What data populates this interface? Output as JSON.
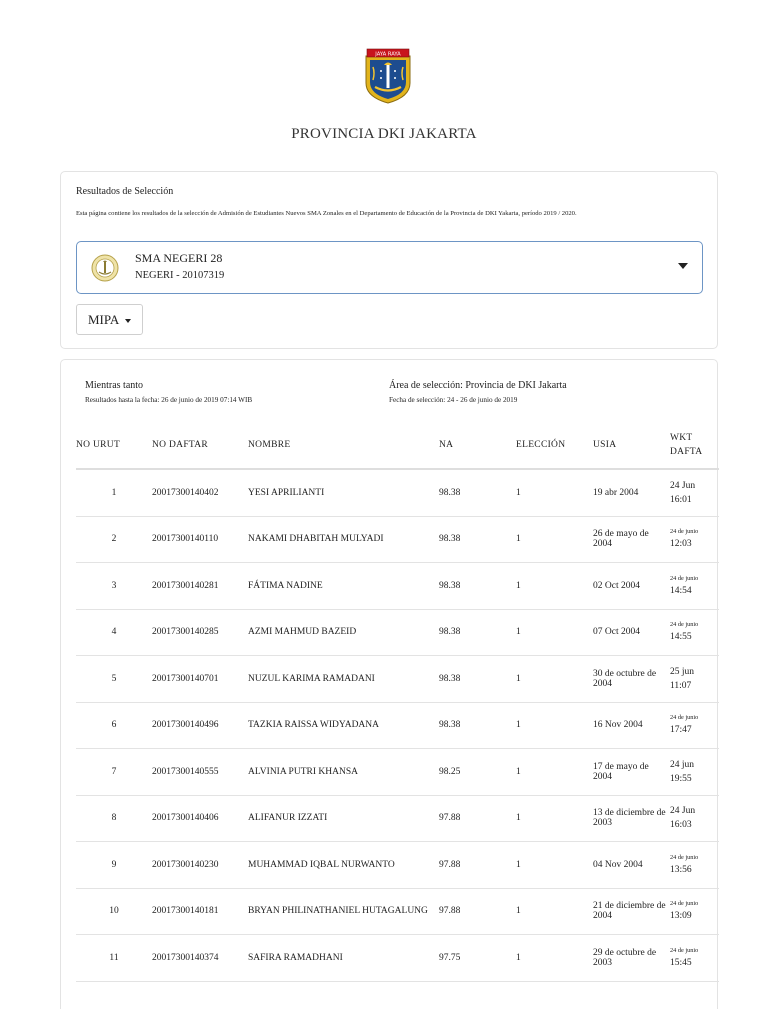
{
  "header": {
    "province_title": "PROVINCIA DKI JAKARTA",
    "logo_banner_text": "JAYA RAYA"
  },
  "selection": {
    "title": "Resultados de Selección",
    "description": "Esta página contiene los resultados de la selección de Admisión de Estudiantes Nuevos SMA Zonales en el Departamento de Educación de la Provincia de DKI Yakarta, período 2019 / 2020.",
    "school_name": "SMA NEGERI 28",
    "school_code": "NEGERI - 20107319",
    "track": "MIPA"
  },
  "results": {
    "status_label": "Mientras tanto",
    "results_date": "Resultados hasta la fecha: 26 de junio de 2019 07:14 WIB",
    "area_label": "Área de selección: Provincia de DKI Jakarta",
    "selection_dates": "Fecha de selección: 24 - 26 de junio de 2019",
    "columns": [
      "NO URUT",
      "NO DAFTAR",
      "NOMBRE",
      "NA",
      "ELECCIÓN",
      "USIA",
      "WKT DAFTA"
    ],
    "rows": [
      {
        "no": "1",
        "daftar": "20017300140402",
        "nombre": "YESI APRILIANTI",
        "na": "98.38",
        "eleccion": "1",
        "usia": "19 abr 2004",
        "usia_small": false,
        "wkt_date": "24 Jun",
        "wkt_time": "16:01",
        "wkt_small": false
      },
      {
        "no": "2",
        "daftar": "20017300140110",
        "nombre": "NAKAMI DHABITAH MULYADI",
        "na": "98.38",
        "eleccion": "1",
        "usia": "26 de mayo de 2004",
        "usia_small": true,
        "wkt_date": "24 de junio",
        "wkt_time": "12:03",
        "wkt_small": true
      },
      {
        "no": "3",
        "daftar": "20017300140281",
        "nombre": "FÁTIMA NADINE",
        "na": "98.38",
        "eleccion": "1",
        "usia": "02 Oct 2004",
        "usia_small": false,
        "wkt_date": "24 de junio",
        "wkt_time": "14:54",
        "wkt_small": true
      },
      {
        "no": "4",
        "daftar": "20017300140285",
        "nombre": "AZMI MAHMUD BAZEID",
        "na": "98.38",
        "eleccion": "1",
        "usia": "07 Oct 2004",
        "usia_small": false,
        "wkt_date": "24 de junio",
        "wkt_time": "14:55",
        "wkt_small": true
      },
      {
        "no": "5",
        "daftar": "20017300140701",
        "nombre": "NUZUL KARIMA RAMADANI",
        "na": "98.38",
        "eleccion": "1",
        "usia": "30 de octubre de 2004",
        "usia_small": true,
        "wkt_date": "25 jun",
        "wkt_time": "11:07",
        "wkt_small": false
      },
      {
        "no": "6",
        "daftar": "20017300140496",
        "nombre": "TAZKIA RAISSA WIDYADANA",
        "na": "98.38",
        "eleccion": "1",
        "usia": "16 Nov 2004",
        "usia_small": false,
        "wkt_date": "24 de junio",
        "wkt_time": "17:47",
        "wkt_small": true
      },
      {
        "no": "7",
        "daftar": "20017300140555",
        "nombre": "ALVINIA PUTRI KHANSA",
        "na": "98.25",
        "eleccion": "1",
        "usia": "17 de mayo de 2004",
        "usia_small": true,
        "wkt_date": "24 jun",
        "wkt_time": "19:55",
        "wkt_small": false
      },
      {
        "no": "8",
        "daftar": "20017300140406",
        "nombre": "ALIFANUR IZZATI",
        "na": "97.88",
        "eleccion": "1",
        "usia": "13 de diciembre de 2003",
        "usia_small": true,
        "wkt_date": "24 Jun",
        "wkt_time": "16:03",
        "wkt_small": false
      },
      {
        "no": "9",
        "daftar": "20017300140230",
        "nombre": "MUHAMMAD IQBAL NURWANTO",
        "na": "97.88",
        "eleccion": "1",
        "usia": "04 Nov 2004",
        "usia_small": false,
        "wkt_date": "24 de junio",
        "wkt_time": "13:56",
        "wkt_small": true
      },
      {
        "no": "10",
        "daftar": "20017300140181",
        "nombre": "BRYAN PHILINATHANIEL HUTAGALUNG",
        "na": "97.88",
        "eleccion": "1",
        "usia": "21 de diciembre de 2004",
        "usia_small": true,
        "wkt_date": "24 de junio",
        "wkt_time": "13:09",
        "wkt_small": true
      },
      {
        "no": "11",
        "daftar": "20017300140374",
        "nombre": "SAFIRA RAMADHANI",
        "na": "97.75",
        "eleccion": "1",
        "usia": "29 de octubre de 2003",
        "usia_small": true,
        "wkt_date": "24 de junio",
        "wkt_time": "15:45",
        "wkt_small": true
      }
    ]
  },
  "icons": {
    "logo": "dki-jakarta-crest-icon",
    "school": "school-emblem-icon",
    "dropdown": "chevron-down-icon"
  },
  "colors": {
    "select_border": "#6d95c5",
    "crest_gold": "#e2b41c",
    "crest_blue": "#1d4c8f"
  }
}
